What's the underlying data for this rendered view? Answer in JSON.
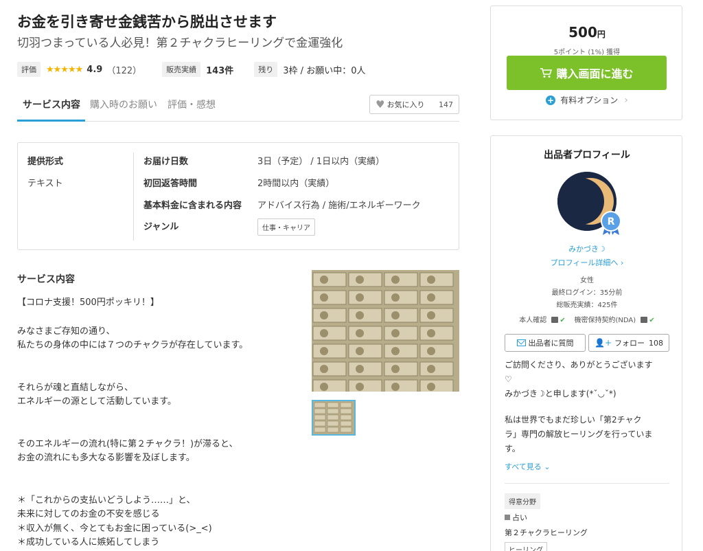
{
  "service": {
    "title": "お金を引き寄せ金銭苦から脱出させます",
    "subtitle": "切羽つまっている人必見！第２チャクラヒーリングで金運強化"
  },
  "meta": {
    "rating_tag": "評価",
    "stars": "★★★★★",
    "rating": "4.9",
    "rating_count": "（122）",
    "sold_tag": "販売実績",
    "sold_count": "143件",
    "remain_tag": "残り",
    "remain_text": "3枠 / お願い中：0人"
  },
  "tabs": [
    {
      "label": "サービス内容"
    },
    {
      "label": "購入時のお願い"
    },
    {
      "label": "評価・感想"
    }
  ],
  "favorite": {
    "label": "お気に入り",
    "count": "147"
  },
  "spec": {
    "format_label": "提供形式",
    "format_value": "テキスト",
    "rows": [
      {
        "label": "お届け日数",
        "value": "3日（予定） / 1日以内（実績）"
      },
      {
        "label": "初回返答時間",
        "value": "2時間以内（実績）"
      },
      {
        "label": "基本料金に含まれる内容",
        "value": "アドバイス行為 / 施術/エネルギーワーク"
      },
      {
        "label": "ジャンル",
        "value": "仕事・キャリア"
      }
    ]
  },
  "content": {
    "heading": "サービス内容",
    "lines": [
      "【コロナ支援！500円ポッキリ！】",
      "みなさまご存知の通り、",
      "私たちの身体の中には７つのチャクラが存在しています。",
      "それらが魂と直結しながら、",
      "エネルギーの源として活動しています。",
      "そのエネルギーの流れ(特に第２チャクラ！)が滞ると、",
      "お金の流れにも多大なる影響を及ぼします。",
      "＊「これからの支払いどうしよう……」と、",
      "未来に対してのお金の不安を感じる",
      "＊収入が無く、今とてもお金に困っている(>_<)",
      "＊成功している人に嫉妬してしまう"
    ]
  },
  "purchase": {
    "price": "500",
    "yen": "円",
    "points": "5ポイント (1%) 獲得",
    "buy_label": "購入画面に進む",
    "option_label": "有料オプション"
  },
  "profile": {
    "title": "出品者プロフィール",
    "name": "みかづき☽",
    "detail_link": "プロフィール詳細へ",
    "gender": "女性",
    "last_login": "最終ログイン：35分前",
    "total_sales": "総販売実績：425件",
    "verify_id": "本人確認",
    "verify_nda": "機密保持契約(NDA)",
    "ask_label": "出品者に質問",
    "follow_label": "フォロー",
    "follow_count": "108",
    "intro_lines": [
      "ご訪問くださり、ありがとうございます",
      "♡",
      "みかづき☽と申します(*ˇ◡ˇ*)",
      "",
      "私は世界でもまだ珍しい「第2チャク",
      "ラ」専門の解放ヒーリングを行っていま",
      "す。"
    ],
    "see_all": "すべて見る",
    "skills_tag": "得意分野",
    "skill_category": "占い",
    "skill_name": "第２チャクラヒーリング",
    "skill_sub": "ヒーリング"
  },
  "colors": {
    "accent": "#2a9fd6",
    "buy_button": "#7dc12a",
    "star": "#f5b400"
  },
  "icons": [
    "heart-icon",
    "cart-icon",
    "plus-circle-icon",
    "chevron-right-icon",
    "mail-icon",
    "person-plus-icon",
    "check-icon",
    "chevron-down-icon"
  ]
}
